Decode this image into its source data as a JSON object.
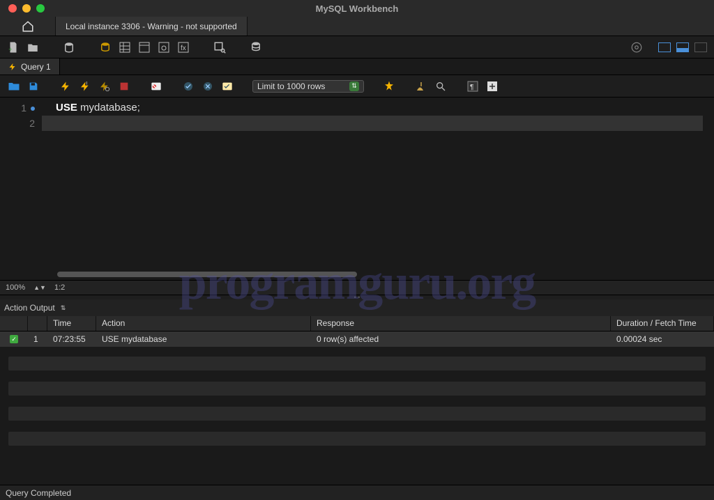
{
  "titlebar": {
    "title": "MySQL Workbench"
  },
  "traffic": {
    "close": "#ff5f57",
    "min": "#febc2e",
    "max": "#28c840"
  },
  "conn_tab": "Local instance 3306 - Warning - not supported",
  "query_tab": "Query 1",
  "limit_select": "Limit to 1000 rows",
  "editor": {
    "lines": [
      "1",
      "2"
    ],
    "code_kw": "USE",
    "code_rest": " mydatabase;",
    "zoom": "100%",
    "cursor": "1:2"
  },
  "watermark": "programguru.org",
  "action_output": {
    "label": "Action Output",
    "columns": {
      "time": "Time",
      "action": "Action",
      "response": "Response",
      "duration": "Duration / Fetch Time"
    },
    "rows": [
      {
        "idx": "1",
        "time": "07:23:55",
        "action": "USE mydatabase",
        "response": "0 row(s) affected",
        "duration": "0.00024 sec"
      }
    ]
  },
  "footer": "Query Completed"
}
